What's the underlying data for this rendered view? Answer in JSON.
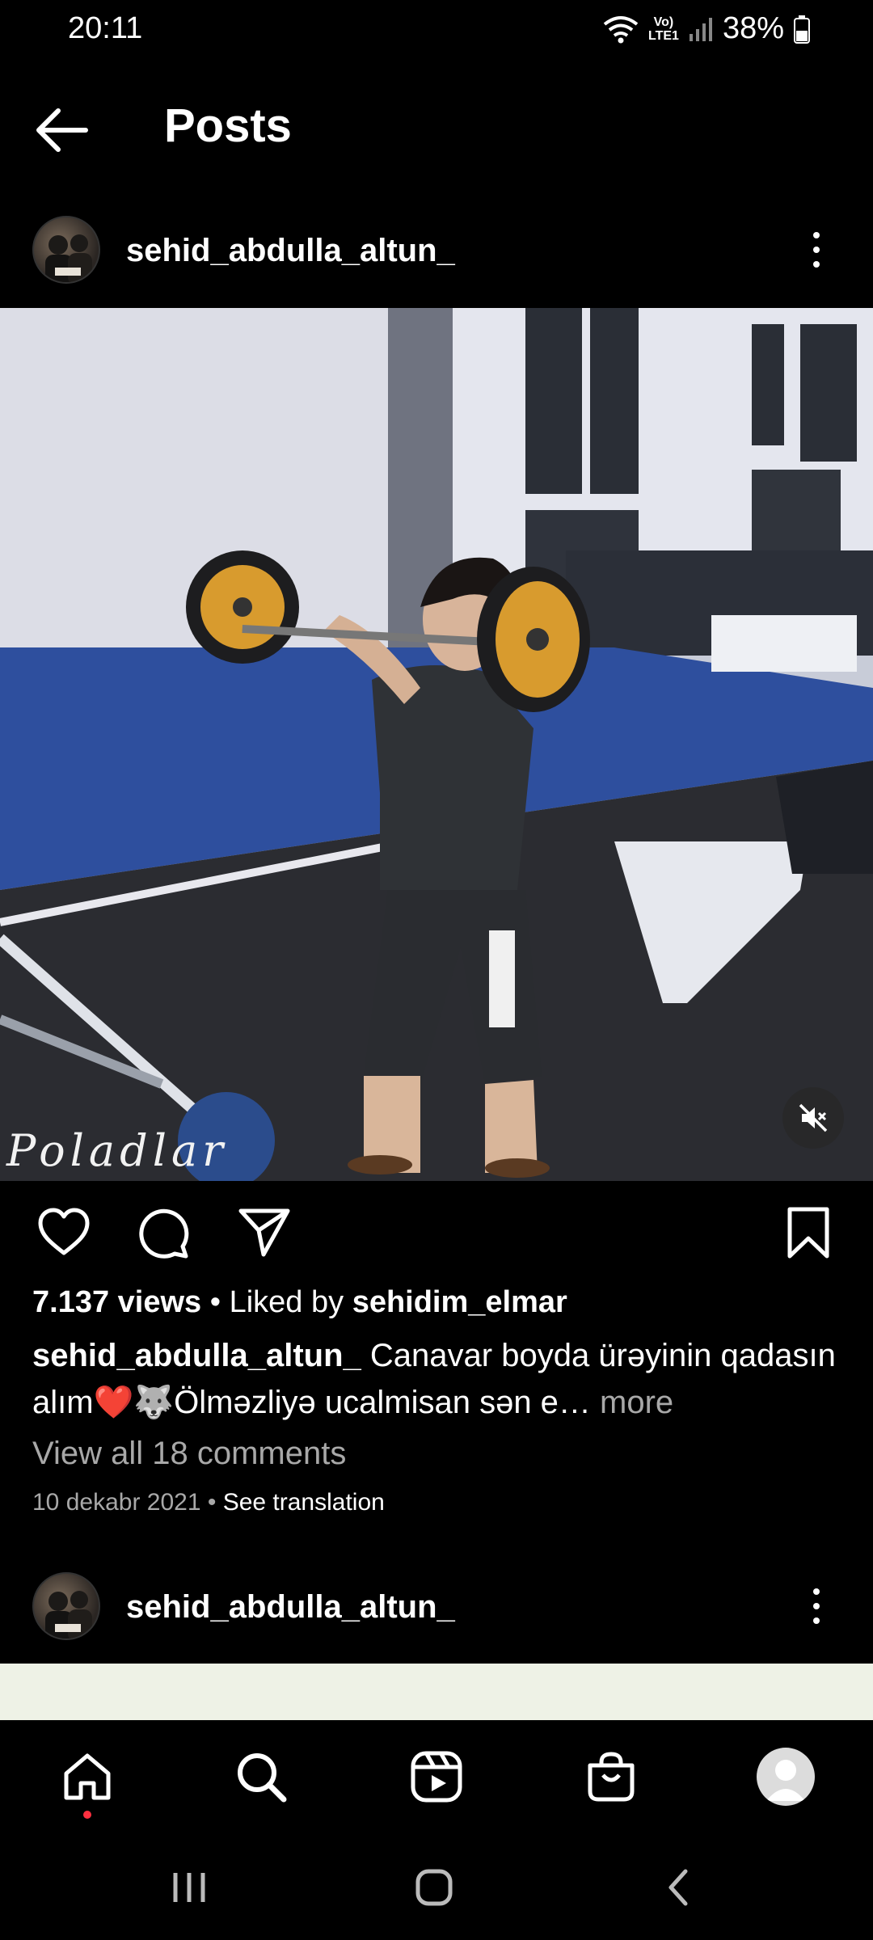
{
  "status": {
    "time": "20:11",
    "battery": "38%",
    "network_label_top": "Vo)",
    "network_label_bottom": "LTE1"
  },
  "header": {
    "title": "Posts"
  },
  "post": {
    "username": "sehid_abdulla_altun_",
    "watermark": "Poladlar",
    "views": "7.137 views",
    "liked_by_prefix": " • Liked by ",
    "liked_by_user": "sehidim_elmar",
    "caption_user": "sehid_abdulla_altun_",
    "caption_text": " Canavar boyda ürəyinin qadasın alım❤️🐺Ölməzliyə ucalmisan sən e…",
    "more_label": " more",
    "comments_link": "View all 18 comments",
    "date": "10 dekabr 2021",
    "date_separator": " • ",
    "translation_link": "See translation"
  },
  "next_post": {
    "username": "sehid_abdulla_altun_"
  },
  "icons": {
    "back": "back-arrow-icon",
    "like": "heart-icon",
    "comment": "comment-icon",
    "share": "send-icon",
    "save": "bookmark-icon",
    "mute": "muted-speaker-icon",
    "nav": [
      "home-icon",
      "search-icon",
      "reels-icon",
      "shop-icon",
      "profile-icon"
    ]
  },
  "colors": {
    "background": "#000000",
    "notification_dot": "#ff3040",
    "secondary_text": "#a8a8a8"
  }
}
